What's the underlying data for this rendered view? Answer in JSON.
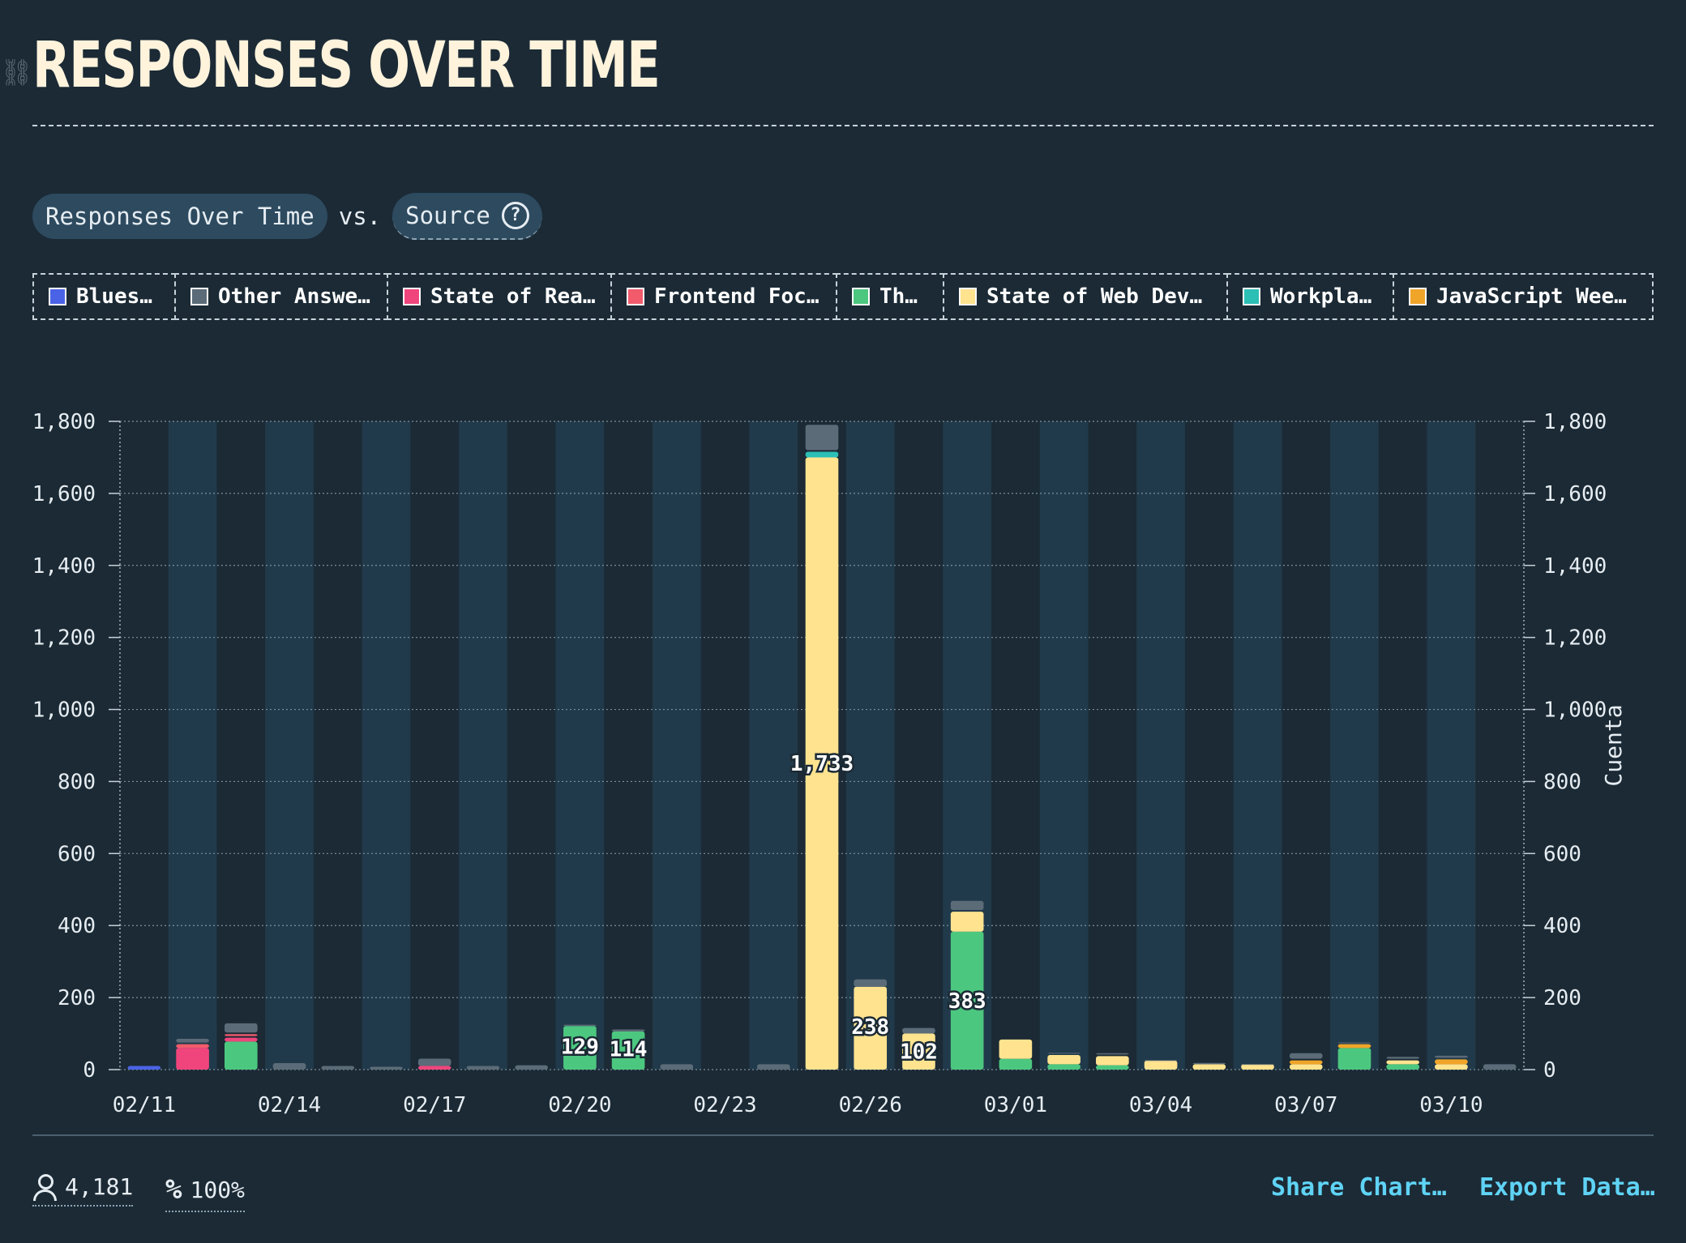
{
  "header": {
    "title": "RESPONSES OVER TIME"
  },
  "controls": {
    "primary": "Responses Over Time",
    "vs": "vs.",
    "secondary": "Source"
  },
  "legend": [
    {
      "label": "Blues…",
      "color": "#4a63e6"
    },
    {
      "label": "Other Answe…",
      "color": "#5b6b77"
    },
    {
      "label": "State of Rea…",
      "color": "#f0457c"
    },
    {
      "label": "Frontend Foc…",
      "color": "#f15b6c"
    },
    {
      "label": "Th…",
      "color": "#4cc77f"
    },
    {
      "label": "State of Web Dev…",
      "color": "#ffe38f"
    },
    {
      "label": "Workpla…",
      "color": "#2cbfb6"
    },
    {
      "label": "JavaScript Wee…",
      "color": "#f0a529"
    }
  ],
  "chart_data": {
    "type": "bar",
    "stacked": true,
    "ylabel": "Cuenta",
    "ylim": [
      0,
      1800
    ],
    "yticks": [
      "0",
      "200",
      "400",
      "600",
      "800",
      "1,000",
      "1,200",
      "1,400",
      "1,600",
      "1,800"
    ],
    "xtick_labels": [
      "02/11",
      "02/14",
      "02/17",
      "02/20",
      "02/23",
      "02/26",
      "03/01",
      "03/04",
      "03/07",
      "03/10"
    ],
    "categories": [
      "02/11",
      "02/12",
      "02/13",
      "02/14",
      "02/15",
      "02/16",
      "02/17",
      "02/18",
      "02/19",
      "02/20",
      "02/21",
      "02/22",
      "02/23",
      "02/24",
      "02/25",
      "02/26",
      "02/27",
      "02/28",
      "03/01",
      "03/02",
      "03/03",
      "03/04",
      "03/05",
      "03/06",
      "03/07",
      "03/08",
      "03/09",
      "03/10",
      "03/11"
    ],
    "grid": true,
    "series": [
      {
        "name": "Blues…",
        "color": "#4a63e6",
        "values": [
          10,
          0,
          0,
          0,
          0,
          0,
          0,
          0,
          0,
          0,
          0,
          0,
          0,
          0,
          0,
          0,
          0,
          0,
          0,
          0,
          0,
          0,
          0,
          0,
          0,
          0,
          0,
          0,
          0
        ]
      },
      {
        "name": "Other Answe…",
        "color": "#5b6b77",
        "values": [
          0,
          15,
          30,
          18,
          10,
          8,
          25,
          10,
          12,
          8,
          10,
          15,
          0,
          15,
          75,
          25,
          20,
          30,
          0,
          6,
          8,
          6,
          8,
          5,
          20,
          5,
          10,
          10,
          15
        ]
      },
      {
        "name": "State of Rea…",
        "color": "#f0457c",
        "values": [
          0,
          60,
          15,
          0,
          0,
          0,
          10,
          0,
          0,
          0,
          0,
          0,
          0,
          0,
          0,
          0,
          0,
          0,
          0,
          0,
          0,
          0,
          0,
          0,
          0,
          0,
          0,
          0,
          0
        ]
      },
      {
        "name": "Frontend Foc…",
        "color": "#f15b6c",
        "values": [
          0,
          15,
          10,
          0,
          0,
          0,
          0,
          0,
          0,
          0,
          0,
          0,
          0,
          0,
          0,
          0,
          0,
          0,
          0,
          0,
          0,
          0,
          0,
          0,
          0,
          0,
          0,
          0,
          0
        ]
      },
      {
        "name": "Th…",
        "color": "#4cc77f",
        "values": [
          0,
          0,
          78,
          0,
          0,
          0,
          0,
          0,
          0,
          121,
          106,
          0,
          0,
          0,
          0,
          0,
          0,
          383,
          30,
          15,
          12,
          0,
          0,
          0,
          0,
          60,
          15,
          0,
          0
        ]
      },
      {
        "name": "State of Web Dev…",
        "color": "#ffe38f",
        "values": [
          0,
          0,
          0,
          0,
          0,
          0,
          0,
          0,
          0,
          0,
          0,
          0,
          0,
          0,
          1700,
          230,
          100,
          60,
          58,
          30,
          30,
          25,
          15,
          15,
          15,
          0,
          15,
          15,
          0
        ]
      },
      {
        "name": "Workpla…",
        "color": "#2cbfb6",
        "values": [
          0,
          0,
          0,
          0,
          0,
          0,
          0,
          0,
          0,
          0,
          0,
          0,
          0,
          0,
          20,
          0,
          0,
          0,
          0,
          0,
          0,
          0,
          0,
          0,
          0,
          0,
          0,
          0,
          0
        ]
      },
      {
        "name": "JavaScript Wee…",
        "color": "#f0a529",
        "values": [
          0,
          0,
          0,
          0,
          0,
          0,
          0,
          0,
          0,
          0,
          0,
          0,
          0,
          0,
          0,
          0,
          0,
          0,
          0,
          0,
          0,
          0,
          0,
          0,
          15,
          15,
          0,
          18,
          0
        ]
      }
    ],
    "data_labels": [
      {
        "category": "02/20",
        "text": "129",
        "value": 129
      },
      {
        "category": "02/21",
        "text": "114",
        "value": 114
      },
      {
        "category": "02/25",
        "text": "1,733",
        "value": 1733
      },
      {
        "category": "02/26",
        "text": "238",
        "value": 238
      },
      {
        "category": "02/27",
        "text": "102",
        "value": 102
      },
      {
        "category": "02/28",
        "text": "383",
        "value": 383
      }
    ]
  },
  "footer": {
    "respondents": "4,181",
    "percent": "100%",
    "share_label": "Share Chart…",
    "export_label": "Export Data…"
  }
}
